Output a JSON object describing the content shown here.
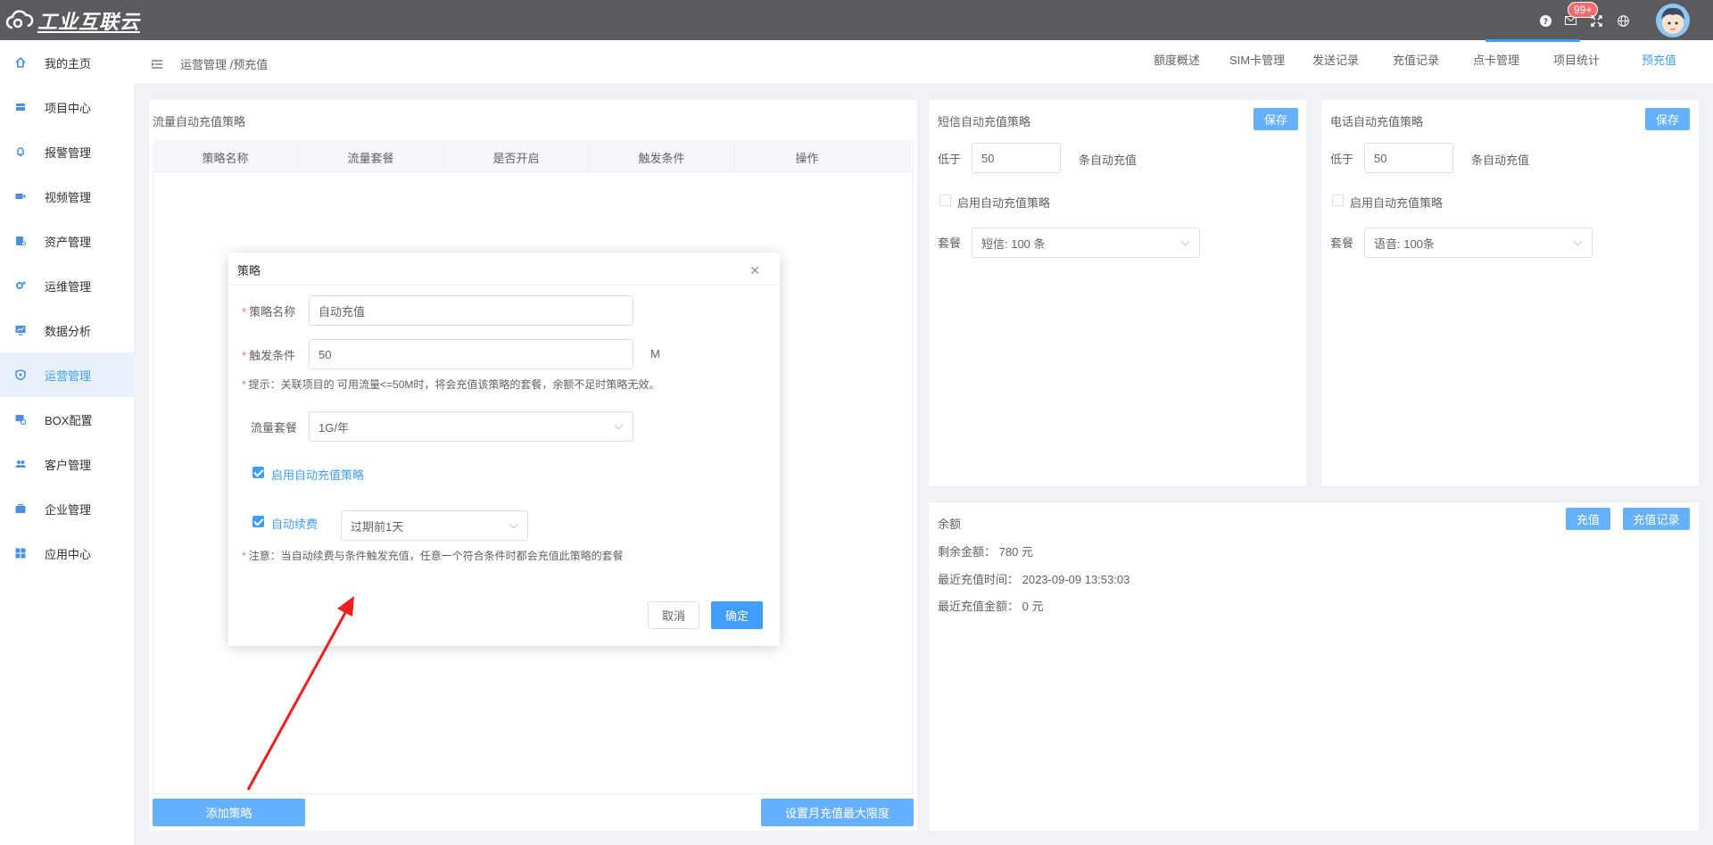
{
  "app": {
    "logo_text": "工业互联云",
    "notification_count": "99+"
  },
  "sidebar": {
    "items": [
      {
        "label": "我的主页"
      },
      {
        "label": "项目中心"
      },
      {
        "label": "报警管理"
      },
      {
        "label": "视频管理"
      },
      {
        "label": "资产管理"
      },
      {
        "label": "运维管理"
      },
      {
        "label": "数据分析"
      },
      {
        "label": "运营管理"
      },
      {
        "label": "BOX配置"
      },
      {
        "label": "客户管理"
      },
      {
        "label": "企业管理"
      },
      {
        "label": "应用中心"
      }
    ],
    "active_item": "运营管理"
  },
  "header": {
    "breadcrumb": "运营管理 /预充值",
    "tabs": [
      {
        "label": "额度概述"
      },
      {
        "label": "SIM卡管理"
      },
      {
        "label": "发送记录"
      },
      {
        "label": "充值记录"
      },
      {
        "label": "点卡管理"
      },
      {
        "label": "项目统计"
      },
      {
        "label": "预充值"
      }
    ],
    "active_tab": "预充值"
  },
  "flow_panel": {
    "title": "流量自动充值策略",
    "columns": [
      "策略名称",
      "流量套餐",
      "是否开启",
      "触发条件",
      "操作"
    ],
    "add_button": "添加策略",
    "limit_button": "设置月充值最大限度"
  },
  "sms_panel": {
    "title": "短信自动充值策略",
    "save_label": "保存",
    "below_label": "低于",
    "below_value": "50",
    "unit_text": "条自动充值",
    "enable_label": "启用自动充值策略",
    "enabled": false,
    "package_label": "套餐",
    "package_value": "短信: 100 条"
  },
  "phone_panel": {
    "title": "电话自动充值策略",
    "save_label": "保存",
    "below_label": "低于",
    "below_value": "50",
    "unit_text": "条自动充值",
    "enable_label": "启用自动充值策略",
    "enabled": false,
    "package_label": "套餐",
    "package_value": "语音: 100条"
  },
  "balance_panel": {
    "title": "余额",
    "recharge_label": "充值",
    "records_label": "充值记录",
    "remaining": "剩余金额： 780 元",
    "last_time": "最近充值时间： 2023-09-09 13:53:03",
    "last_amount": "最近充值金额： 0 元"
  },
  "dialog": {
    "title": "策略",
    "name_label": "策略名称",
    "name_value": "自动充值",
    "trigger_label": "触发条件",
    "trigger_value": "50",
    "trigger_unit": "M",
    "hint": "提示：关联项目的 可用流量<=50M时，将会充值该策略的套餐，余额不足时策略无效。",
    "package_label": "流量套餐",
    "package_value": "1G/年",
    "enable_label": "启用自动充值策略",
    "enable_checked": true,
    "renew_label": "自动续费",
    "renew_checked": true,
    "renew_option": "过期前1天",
    "note": "注意：当自动续费与条件触发充值，任意一个符合条件时都会充值此策略的套餐",
    "cancel_label": "取消",
    "confirm_label": "确定"
  }
}
